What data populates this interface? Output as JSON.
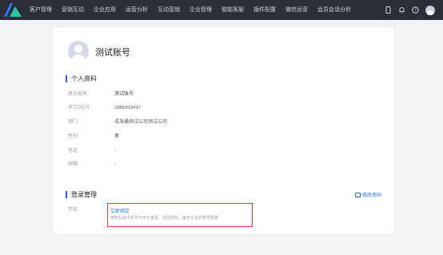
{
  "nav": {
    "items": [
      "客户管理",
      "营销互动",
      "企业应用",
      "运营分析",
      "互动营销",
      "企业管理",
      "智能客服",
      "插件配置",
      "微信运营",
      "会员会话分析"
    ],
    "icons": [
      "phone-icon",
      "bell-icon",
      "help-icon",
      "user-avatar"
    ]
  },
  "profile": {
    "name": "测试账号",
    "section_personal": "个人资料",
    "fields": [
      {
        "label": "真实姓名",
        "value": "测试账号"
      },
      {
        "label": "员工QQ号",
        "value": "2885833437"
      },
      {
        "label": "部门",
        "value": "成海通测试公司测试公司"
      },
      {
        "label": "性别",
        "value": "男"
      },
      {
        "label": "电话",
        "value": "-"
      },
      {
        "label": "邮箱",
        "value": "-"
      }
    ]
  },
  "login": {
    "section_title": "登录管理",
    "change_password": "修改密码",
    "phone_label": "手机",
    "bind_link": "立即绑定",
    "bind_hint": "绑定后该手机号可用于登录、找回密码，备份企业的账号数据"
  },
  "colors": {
    "accent": "#2b6de0",
    "highlight": "#e0322e",
    "topbar": "#2b2f3a"
  }
}
